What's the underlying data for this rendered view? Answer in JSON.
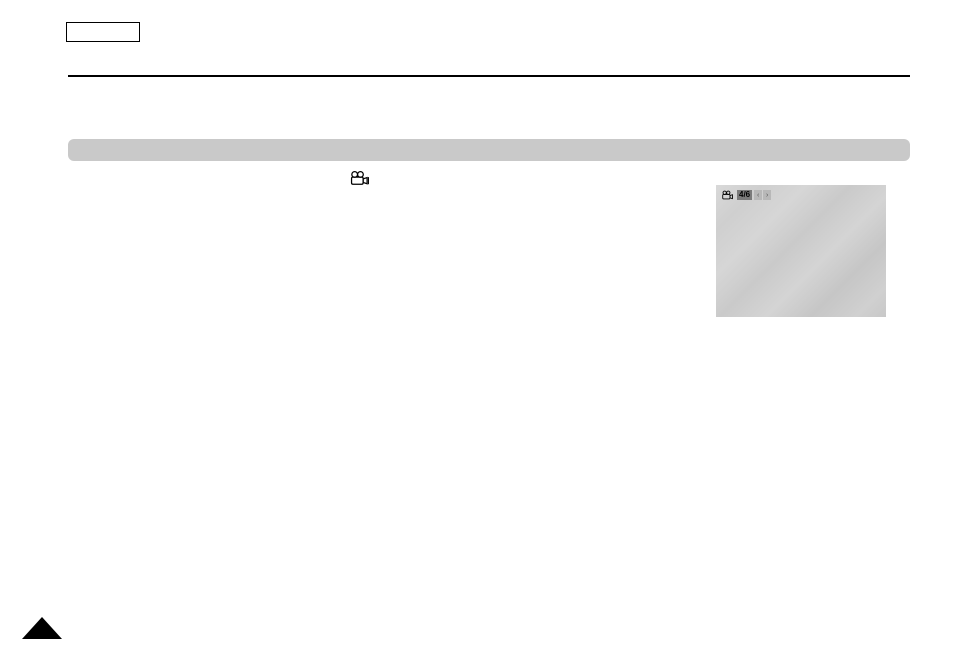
{
  "preview": {
    "counter": "4/6",
    "nav_left": "‹",
    "nav_right": "›"
  }
}
